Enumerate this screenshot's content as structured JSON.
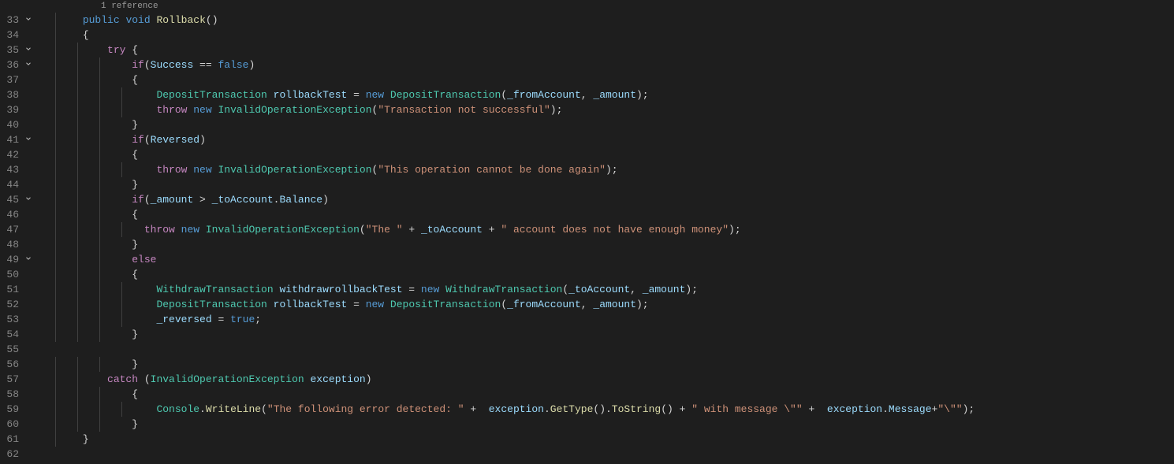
{
  "codelens": {
    "references": "1 reference"
  },
  "gutter": {
    "start": 33,
    "end": 62,
    "foldable": [
      33,
      35,
      36,
      41,
      45,
      49
    ]
  },
  "code": {
    "l33": {
      "kw1": "public",
      "kw2": "void",
      "name": "Rollback",
      "paren": "()"
    },
    "l34": {
      "brace": "{"
    },
    "l35": {
      "kw": "try",
      "brace": " {"
    },
    "l36": {
      "kw": "if",
      "open": "(",
      "v1": "Success",
      "op": " == ",
      "v2": "false",
      "close": ")"
    },
    "l37": {
      "brace": "{"
    },
    "l38": {
      "t1": "DepositTransaction",
      "v1": " rollbackTest",
      "op": " = ",
      "kw": "new",
      "t2": " DepositTransaction",
      "args_open": "(",
      "a1": "_fromAccount",
      "comma": ", ",
      "a2": "_amount",
      "args_close": ");"
    },
    "l39": {
      "kw1": "throw",
      "kw2": " new",
      "t": " InvalidOperationException",
      "open": "(",
      "s": "\"Transaction not successful\"",
      "close": ");"
    },
    "l40": {
      "brace": "}"
    },
    "l41": {
      "kw": "if",
      "open": "(",
      "v": "Reversed",
      "close": ")"
    },
    "l42": {
      "brace": "{"
    },
    "l43": {
      "kw1": "throw",
      "kw2": " new",
      "t": " InvalidOperationException",
      "open": "(",
      "s": "\"This operation cannot be done again\"",
      "close": ");"
    },
    "l44": {
      "brace": "}"
    },
    "l45": {
      "kw": "if",
      "open": "(",
      "v1": "_amount",
      "op": " > ",
      "v2": "_toAccount",
      "dot": ".",
      "v3": "Balance",
      "close": ")"
    },
    "l46": {
      "brace": "{"
    },
    "l47": {
      "kw1": "throw",
      "kw2": " new",
      "t": " InvalidOperationException",
      "open": "(",
      "s1": "\"The \"",
      "op1": " + ",
      "v": "_toAccount",
      "op2": " + ",
      "s2": "\" account does not have enough money\"",
      "close": ");"
    },
    "l48": {
      "brace": "}"
    },
    "l49": {
      "kw": "else"
    },
    "l50": {
      "brace": "{"
    },
    "l51": {
      "t1": "WithdrawTransaction",
      "v1": " withdrawrollbackTest",
      "op": " = ",
      "kw": "new",
      "t2": " WithdrawTransaction",
      "args_open": "(",
      "a1": "_toAccount",
      "comma": ", ",
      "a2": "_amount",
      "args_close": ");"
    },
    "l52": {
      "t1": "DepositTransaction",
      "v1": " rollbackTest",
      "op": " = ",
      "kw": "new",
      "t2": " DepositTransaction",
      "args_open": "(",
      "a1": "_fromAccount",
      "comma": ", ",
      "a2": "_amount",
      "args_close": ");"
    },
    "l53": {
      "v": "_reversed",
      "op": " = ",
      "val": "true",
      "semi": ";"
    },
    "l54": {
      "brace": "}"
    },
    "l55": {
      "blank": ""
    },
    "l56": {
      "brace": "}"
    },
    "l57": {
      "kw": "catch",
      "open": " (",
      "t": "InvalidOperationException",
      "v": " exception",
      "close": ")"
    },
    "l58": {
      "brace": "{"
    },
    "l59": {
      "t": "Console",
      "dot1": ".",
      "m": "WriteLine",
      "open": "(",
      "s1": "\"The following error detected: \"",
      "op1": " +  ",
      "v1": "exception",
      "dot2": ".",
      "m2": "GetType",
      "p2": "().",
      "m3": "ToString",
      "p3": "()",
      "op2": " + ",
      "s2": "\" with message \\\"\"",
      "op3": " +  ",
      "v2": "exception",
      "dot3": ".",
      "f": "Message",
      "plus": "+",
      "s3": "\"\\\"\"",
      "close": ");"
    },
    "l60": {
      "brace": "}"
    },
    "l61": {
      "brace": "}"
    },
    "l62": {
      "blank": ""
    }
  }
}
